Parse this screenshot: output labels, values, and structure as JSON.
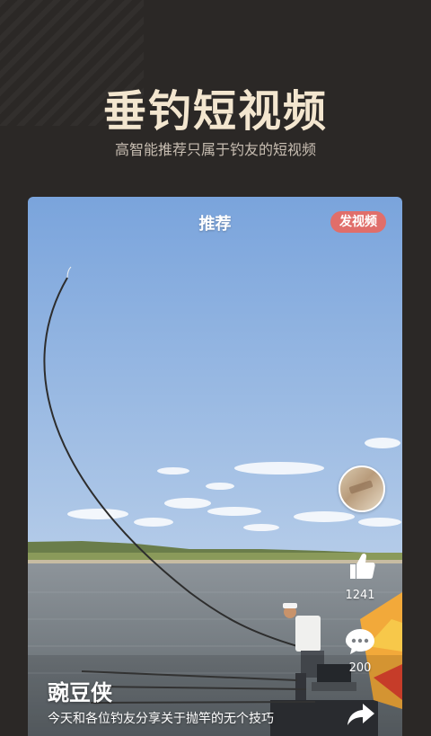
{
  "hero": {
    "title": "垂钓短视频",
    "subtitle": "高智能推荐只属于钓友的短视频"
  },
  "card": {
    "header_title": "推荐",
    "post_video_label": "发视频",
    "likes": "1241",
    "comments": "200",
    "author": "豌豆侠",
    "caption": "今天和各位钓友分享关于抛竿的无个技巧"
  },
  "colors": {
    "page_background": "#2b2826",
    "title_color": "#f3e6cf",
    "post_button": "#e06e6a"
  },
  "icons": [
    "like-icon",
    "comment-icon",
    "share-icon"
  ]
}
